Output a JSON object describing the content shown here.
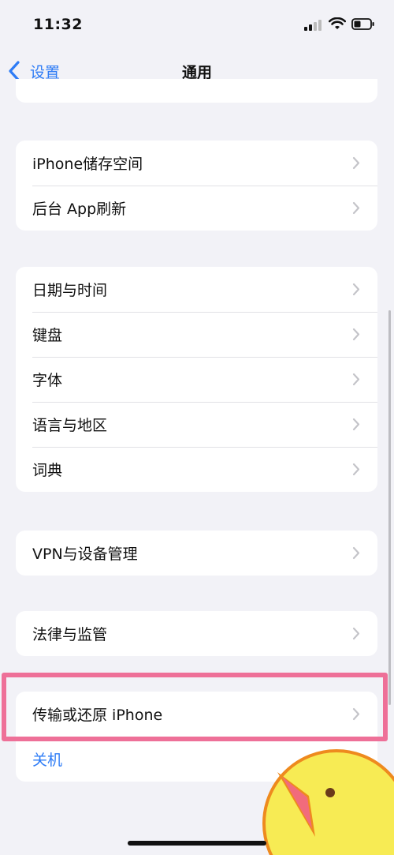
{
  "status_bar": {
    "time": "11:32",
    "icons": [
      "cellular-signal-icon",
      "wifi-icon",
      "battery-icon"
    ]
  },
  "nav": {
    "back_label": "设置",
    "title": "通用",
    "accent_color": "#2e7cf6"
  },
  "groups": [
    {
      "items": [
        {
          "label": "iPhone储存空间"
        },
        {
          "label": "后台 App刷新"
        }
      ]
    },
    {
      "items": [
        {
          "label": "日期与时间"
        },
        {
          "label": "键盘"
        },
        {
          "label": "字体"
        },
        {
          "label": "语言与地区"
        },
        {
          "label": "词典"
        }
      ]
    },
    {
      "items": [
        {
          "label": "VPN与设备管理"
        }
      ]
    },
    {
      "items": [
        {
          "label": "法律与监管"
        }
      ]
    },
    {
      "items": [
        {
          "label": "传输或还原 iPhone",
          "highlighted": true
        }
      ]
    }
  ],
  "shutdown_label": "关机",
  "highlight_color": "#ee7098"
}
